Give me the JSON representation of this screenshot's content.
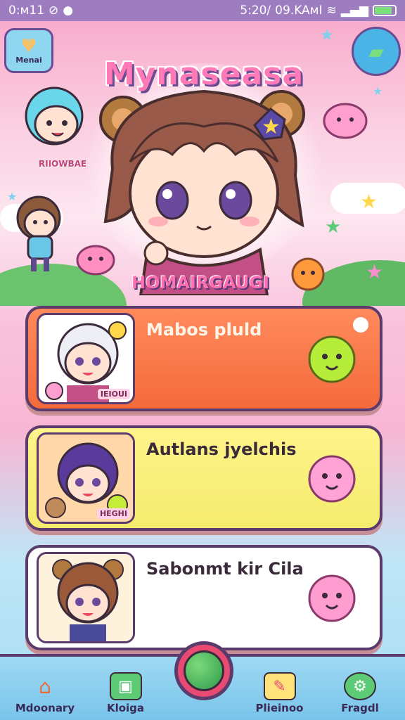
{
  "status_bar": {
    "left_text": "0:ᴍ11",
    "time": "5:20/",
    "carrier": "09.KAᴍI",
    "battery_level": 0.85
  },
  "header": {
    "menu_label": "Menai",
    "game_title": "Mynaseasa",
    "side_tag": "RIIOWBAE",
    "hero_name": "HOMAIRGAUGI"
  },
  "cards": [
    {
      "title": "Mabos pluld",
      "thumb_tag": "IEIOUI",
      "color": "#f46a3c"
    },
    {
      "title": "Autlans jyelchis",
      "thumb_tag": "HEGHI",
      "color": "#f4eb6e"
    },
    {
      "title": "Sabonmt kir Cila",
      "thumb_tag": "",
      "color": "#ffffff"
    }
  ],
  "bottom_nav": {
    "items": [
      {
        "label": "Mdoonary",
        "icon": "home-icon"
      },
      {
        "label": "Kloiga",
        "icon": "gallery-icon"
      },
      {
        "label": "Plieinoo",
        "icon": "map-icon"
      },
      {
        "label": "Fragdl",
        "icon": "settings-icon"
      }
    ],
    "center_icon": "globe-icon"
  },
  "colors": {
    "accent_pink": "#ff7ab7",
    "outline": "#5a3b6b",
    "status_bar": "#9d7cc0"
  }
}
